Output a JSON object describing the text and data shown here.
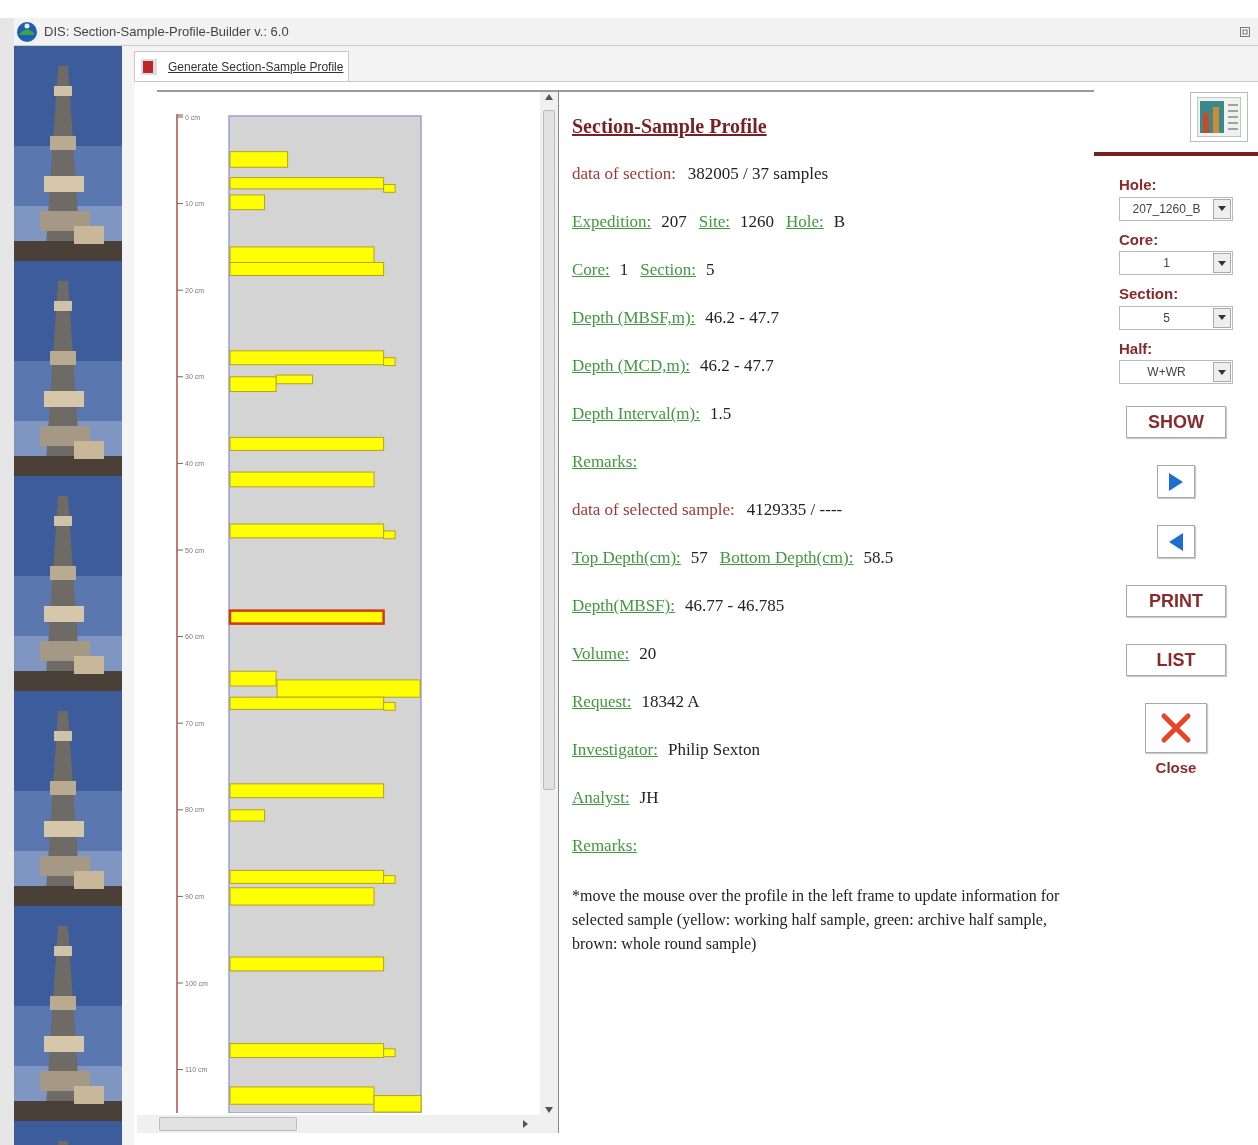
{
  "window": {
    "title": "DIS: Section-Sample-Profile-Builder v.: 6.0"
  },
  "tabs": [
    {
      "label": "Generate Section-Sample Profile",
      "selected": true
    }
  ],
  "profile": {
    "samples": [
      {
        "selected": false
      },
      {
        "selected": false
      },
      {
        "selected": false
      },
      {
        "selected": false
      },
      {
        "selected": false
      },
      {
        "selected": false
      },
      {
        "selected": false
      },
      {
        "selected": false
      },
      {
        "selected": false
      },
      {
        "selected": false
      },
      {
        "selected": false
      },
      {
        "selected": false
      },
      {
        "selected": false
      },
      {
        "selected": false
      },
      {
        "selected": true
      },
      {
        "selected": false
      },
      {
        "selected": false
      },
      {
        "selected": false
      },
      {
        "selected": false
      },
      {
        "selected": false
      },
      {
        "selected": false
      },
      {
        "selected": false
      },
      {
        "selected": false
      },
      {
        "selected": false
      },
      {
        "selected": false
      },
      {
        "selected": false
      },
      {
        "selected": false
      },
      {
        "selected": false
      },
      {
        "selected": false
      }
    ],
    "depth_labels": [
      "0 cm",
      "10 cm",
      "20 cm",
      "30 cm",
      "40 cm",
      "50 cm",
      "60 cm",
      "70 cm",
      "80 cm",
      "90 cm",
      "100 cm",
      "110 cm"
    ]
  },
  "info": {
    "title": "Section-Sample Profile",
    "lines": [
      {
        "kind": "caption",
        "label": "data of section:",
        "value": "382005 / 37 samples"
      },
      {
        "kind": "fields",
        "fields": [
          {
            "label": "Expedition:",
            "value": "207"
          },
          {
            "label": "Site:",
            "value": "1260"
          },
          {
            "label": "Hole:",
            "value": "B"
          }
        ]
      },
      {
        "kind": "fields",
        "fields": [
          {
            "label": "Core:",
            "value": "1"
          },
          {
            "label": "Section:",
            "value": "5"
          }
        ]
      },
      {
        "kind": "fields",
        "fields": [
          {
            "label": "Depth (MBSF,m):",
            "value": "46.2 - 47.7"
          }
        ]
      },
      {
        "kind": "fields",
        "fields": [
          {
            "label": "Depth (MCD,m):",
            "value": "46.2 - 47.7"
          }
        ]
      },
      {
        "kind": "fields",
        "fields": [
          {
            "label": "Depth Interval(m):",
            "value": "1.5"
          }
        ]
      },
      {
        "kind": "fields",
        "fields": [
          {
            "label": "Remarks:"
          }
        ]
      },
      {
        "kind": "caption",
        "label": "data of selected sample:",
        "value": "4129335 / ----"
      },
      {
        "kind": "fields",
        "fields": [
          {
            "label": "Top Depth(cm):",
            "value": "57"
          },
          {
            "label": "Bottom Depth(cm):",
            "value": "58.5"
          }
        ]
      },
      {
        "kind": "fields",
        "fields": [
          {
            "label": "Depth(MBSF):",
            "value": "46.77 - 46.785"
          }
        ]
      },
      {
        "kind": "fields",
        "fields": [
          {
            "label": "Volume:",
            "value": "20"
          }
        ]
      },
      {
        "kind": "fields",
        "fields": [
          {
            "label": "Request:",
            "value": "18342 A"
          }
        ]
      },
      {
        "kind": "fields",
        "fields": [
          {
            "label": "Investigator:",
            "value": "Philip Sexton"
          }
        ]
      },
      {
        "kind": "fields",
        "fields": [
          {
            "label": "Analyst:",
            "value": "JH"
          }
        ]
      },
      {
        "kind": "fields",
        "fields": [
          {
            "label": "Remarks:"
          }
        ]
      },
      {
        "kind": "note",
        "text": "*move the mouse over the profile in the left frame to update information for selected sample (yellow: working half sample, green: archive half sample, brown: whole round sample)"
      }
    ]
  },
  "controls": {
    "selects": [
      {
        "label": "Hole:",
        "value": "207_1260_B"
      },
      {
        "label": "Core:",
        "value": "1"
      },
      {
        "label": "Section:",
        "value": "5"
      },
      {
        "label": "Half:",
        "value": "W+WR"
      }
    ],
    "buttons": [
      {
        "kind": "text",
        "label": "SHOW"
      },
      {
        "kind": "next"
      },
      {
        "kind": "prev"
      },
      {
        "kind": "text",
        "label": "PRINT"
      },
      {
        "kind": "text",
        "label": "LIST"
      },
      {
        "kind": "close",
        "label": "Close"
      }
    ]
  }
}
